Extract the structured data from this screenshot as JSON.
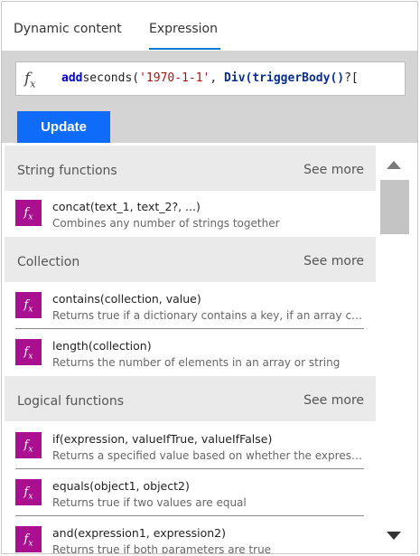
{
  "tabs": [
    {
      "label": "Dynamic content",
      "active": false
    },
    {
      "label": "Expression",
      "active": true
    }
  ],
  "expression": {
    "icon": "fx-icon",
    "kw": "add",
    "fn": "seconds(",
    "str": "'1970-1-1'",
    "mid": ", ",
    "fn2": "Div(triggerBody()",
    "tail": "?["
  },
  "update_label": "Update",
  "sections": [
    {
      "title": "String functions",
      "see_more": "See more",
      "items": [
        {
          "name": "concat(text_1, text_2?, ...)",
          "desc": "Combines any number of strings together"
        }
      ]
    },
    {
      "title": "Collection",
      "see_more": "See more",
      "items": [
        {
          "name": "contains(collection, value)",
          "desc": "Returns true if a dictionary contains a key, if an array contains a value, or if a string contains a substring"
        },
        {
          "name": "length(collection)",
          "desc": "Returns the number of elements in an array or string"
        }
      ]
    },
    {
      "title": "Logical functions",
      "see_more": "See more",
      "items": [
        {
          "name": "if(expression, valueIfTrue, valueIfFalse)",
          "desc": "Returns a specified value based on whether the expression resulted in true or false"
        },
        {
          "name": "equals(object1, object2)",
          "desc": "Returns true if two values are equal"
        },
        {
          "name": "and(expression1, expression2)",
          "desc": "Returns true if both parameters are true"
        }
      ]
    }
  ],
  "colors": {
    "accent": "#0078d4",
    "update_button": "#0f6cfb",
    "function_icon": "#aa0f8f",
    "section_bg": "#eaeaea"
  }
}
